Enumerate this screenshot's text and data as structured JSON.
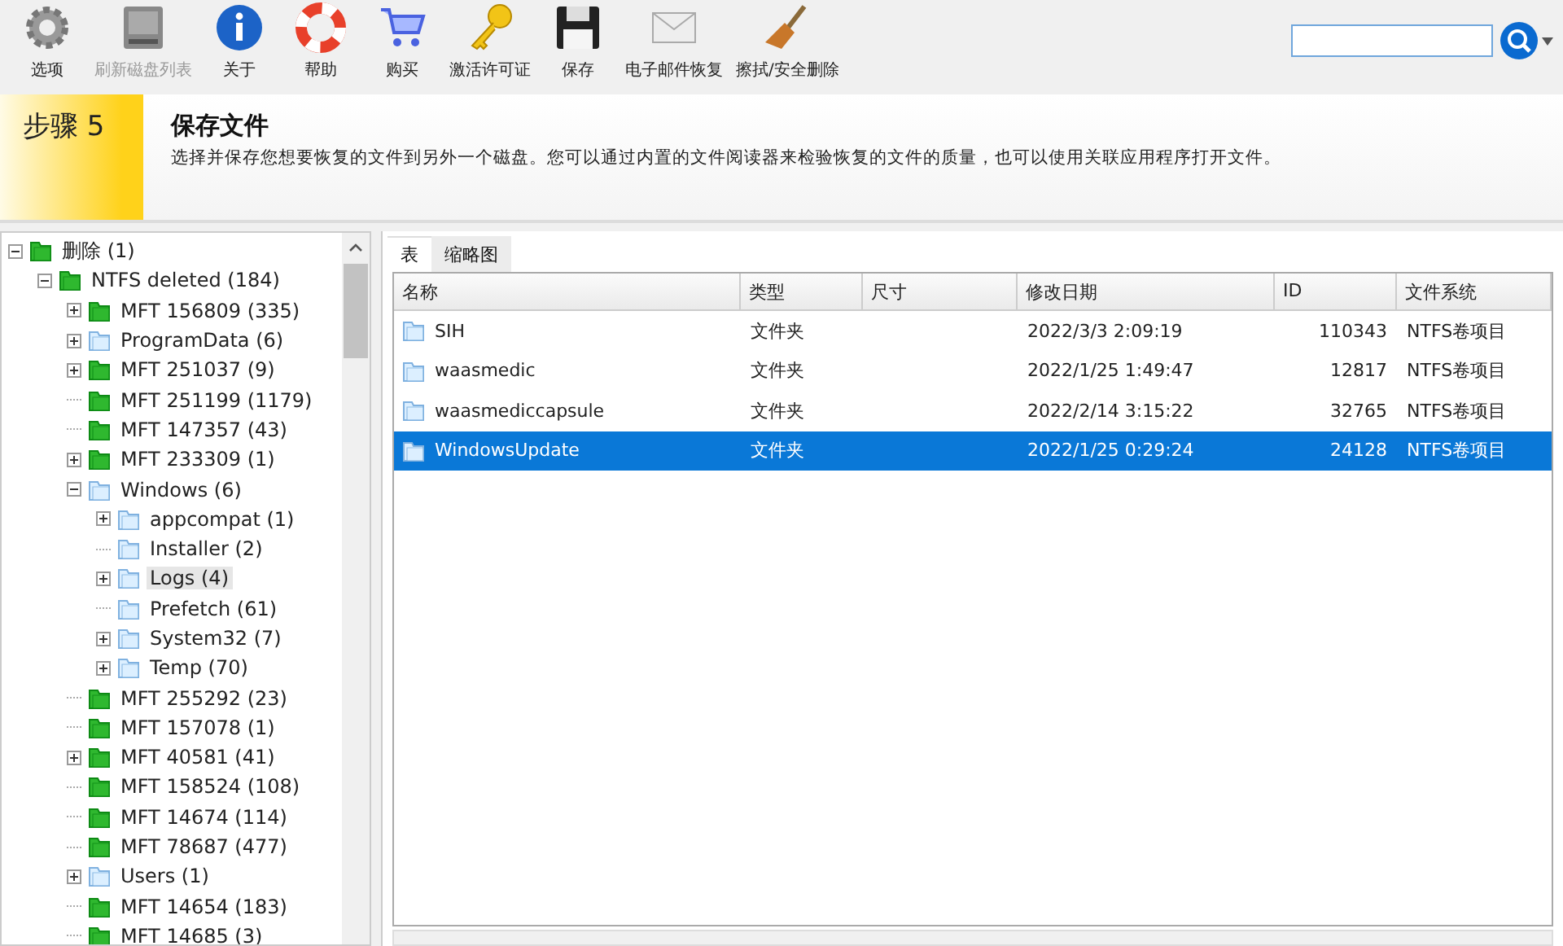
{
  "toolbar": [
    {
      "label": "选项",
      "disabled": false
    },
    {
      "label": "刷新磁盘列表",
      "disabled": true
    },
    {
      "label": "关于",
      "disabled": false
    },
    {
      "label": "帮助",
      "disabled": false
    },
    {
      "label": "购买",
      "disabled": false
    },
    {
      "label": "激活许可证",
      "disabled": false
    },
    {
      "label": "保存",
      "disabled": false
    },
    {
      "label": "电子邮件恢复",
      "disabled": false
    },
    {
      "label": "擦拭/安全删除",
      "disabled": false
    }
  ],
  "step": {
    "label": "步骤 5",
    "title": "保存文件",
    "description": "选择并保存您想要恢复的文件到另外一个磁盘。您可以通过内置的文件阅读器来检验恢复的文件的质量，也可以使用关联应用程序打开文件。"
  },
  "tree": [
    {
      "label": "删除 (1)",
      "kind": "deleted",
      "expanded": true,
      "selected": false,
      "children": [
        {
          "label": "NTFS deleted (184)",
          "kind": "deleted",
          "expanded": true,
          "selected": false,
          "children": [
            {
              "label": "MFT 156809 (335)",
              "kind": "deleted",
              "expanded": false,
              "selected": false
            },
            {
              "label": "ProgramData (6)",
              "kind": "folder",
              "expanded": false,
              "selected": false
            },
            {
              "label": "MFT 251037 (9)",
              "kind": "deleted",
              "expanded": false,
              "selected": false
            },
            {
              "label": "MFT 251199 (1179)",
              "kind": "deleted",
              "selected": false
            },
            {
              "label": "MFT 147357 (43)",
              "kind": "deleted",
              "selected": false
            },
            {
              "label": "MFT 233309 (1)",
              "kind": "deleted",
              "expanded": false,
              "selected": false
            },
            {
              "label": "Windows (6)",
              "kind": "folder",
              "expanded": true,
              "selected": false,
              "children": [
                {
                  "label": "appcompat (1)",
                  "kind": "folder",
                  "expanded": false,
                  "selected": false
                },
                {
                  "label": "Installer (2)",
                  "kind": "folder",
                  "selected": false
                },
                {
                  "label": "Logs (4)",
                  "kind": "folder",
                  "expanded": false,
                  "selected": true
                },
                {
                  "label": "Prefetch (61)",
                  "kind": "folder",
                  "selected": false
                },
                {
                  "label": "System32 (7)",
                  "kind": "folder",
                  "expanded": false,
                  "selected": false
                },
                {
                  "label": "Temp (70)",
                  "kind": "folder",
                  "expanded": false,
                  "selected": false
                }
              ]
            },
            {
              "label": "MFT 255292 (23)",
              "kind": "deleted",
              "selected": false
            },
            {
              "label": "MFT 157078 (1)",
              "kind": "deleted",
              "selected": false
            },
            {
              "label": "MFT 40581 (41)",
              "kind": "deleted",
              "expanded": false,
              "selected": false
            },
            {
              "label": "MFT 158524 (108)",
              "kind": "deleted",
              "selected": false
            },
            {
              "label": "MFT 14674 (114)",
              "kind": "deleted",
              "selected": false
            },
            {
              "label": "MFT 78687 (477)",
              "kind": "deleted",
              "selected": false
            },
            {
              "label": "Users (1)",
              "kind": "folder",
              "expanded": false,
              "selected": false
            },
            {
              "label": "MFT 14654 (183)",
              "kind": "deleted",
              "selected": false
            },
            {
              "label": "MFT 14685 (3)",
              "kind": "deleted",
              "selected": false
            }
          ]
        }
      ]
    }
  ],
  "tabs": [
    {
      "label": "表",
      "selected": true
    },
    {
      "label": "缩略图",
      "selected": false
    }
  ],
  "table": {
    "columns": [
      "名称",
      "类型",
      "尺寸",
      "修改日期",
      "ID",
      "文件系统"
    ],
    "rows": [
      {
        "name": "SIH",
        "type": "文件夹",
        "modified": "2022/3/3 2:09:19",
        "id": "110343",
        "fs": "NTFS卷项目",
        "selected": false
      },
      {
        "name": "waasmedic",
        "type": "文件夹",
        "modified": "2022/1/25 1:49:47",
        "id": "12817",
        "fs": "NTFS卷项目",
        "selected": false
      },
      {
        "name": "waasmediccapsule",
        "type": "文件夹",
        "modified": "2022/2/14 3:15:22",
        "id": "32765",
        "fs": "NTFS卷项目",
        "selected": false
      },
      {
        "name": "WindowsUpdate",
        "type": "文件夹",
        "modified": "2022/1/25 0:29:24",
        "id": "24128",
        "fs": "NTFS卷项目",
        "selected": true
      }
    ]
  }
}
